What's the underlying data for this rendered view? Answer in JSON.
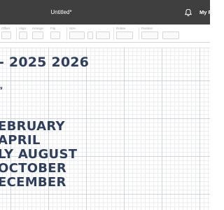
{
  "app": {
    "document_title": "Untitled*",
    "projects_label": "My P"
  },
  "toolbar": {
    "groups": [
      {
        "label": "Offset"
      },
      {
        "label": "Align"
      },
      {
        "label": "Arrange"
      },
      {
        "label": "Flip"
      },
      {
        "label": "Size"
      },
      {
        "label": "Rotate"
      },
      {
        "label": "Position"
      }
    ]
  },
  "design": {
    "years_line": "- 2025 2026",
    "tiny_line_1": "9",
    "tiny_line_2": "",
    "months": [
      "EBRUARY",
      "APRIL",
      "LY AUGUST",
      "OCTOBER",
      "ECEMBER"
    ]
  },
  "colors": {
    "topbar": "#3f3f3f",
    "design_text": "#2f3e5c",
    "grid_major": "#cfd4d8",
    "grid_minor": "#eceef0"
  },
  "icons": {
    "notifications": "bell-icon"
  }
}
